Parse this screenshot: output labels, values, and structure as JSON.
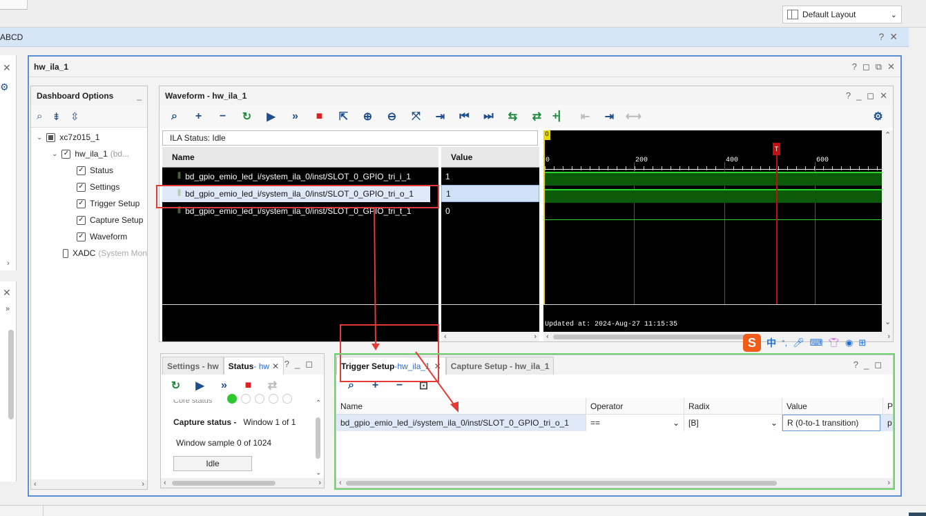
{
  "layout_selector": {
    "value": "Default Layout"
  },
  "project_bar": {
    "title": "ABCD"
  },
  "main_window": {
    "title": "hw_ila_1"
  },
  "dashboard": {
    "title": "Dashboard Options",
    "device": "xc7z015_1",
    "ila": "hw_ila_1",
    "ila_suffix": "(bd...",
    "items": [
      "Status",
      "Settings",
      "Trigger Setup",
      "Capture Setup",
      "Waveform"
    ],
    "xadc": "XADC",
    "xadc_suffix": "(System Mon"
  },
  "waveform": {
    "title": "Waveform - hw_ila_1",
    "ila_status": "ILA Status:  Idle",
    "name_header": "Name",
    "value_header": "Value",
    "signals": [
      {
        "name": "bd_gpio_emio_led_i/system_ila_0/inst/SLOT_0_GPIO_tri_i_1",
        "value": "1"
      },
      {
        "name": "bd_gpio_emio_led_i/system_ila_0/inst/SLOT_0_GPIO_tri_o_1",
        "value": "1"
      },
      {
        "name": "bd_gpio_emio_led_i/system_ila_0/inst/SLOT_0_GPIO_tri_t_1",
        "value": "0"
      }
    ],
    "ticks": [
      "0",
      "200",
      "400",
      "600"
    ],
    "zero_marker": "0",
    "trigger_marker": "T",
    "updated": "Updated at: 2024-Aug-27 11:15:35"
  },
  "status_panel": {
    "tab_settings": "Settings - hw",
    "tab_status": "Status",
    "tab_status_suffix": " - hw",
    "core_status_cut": "Core status",
    "capture_label": "Capture status -",
    "capture_window": "Window 1 of 1",
    "window_sample": "Window sample 0 of 1024",
    "state": "Idle"
  },
  "trigger_panel": {
    "tab_trigger": "Trigger Setup",
    "tab_trigger_suffix": "hw_ila_1",
    "tab_capture": "Capture Setup - hw_ila_1",
    "columns": [
      "Name",
      "Operator",
      "Radix",
      "Value",
      "P"
    ],
    "row": {
      "name": "bd_gpio_emio_led_i/system_ila_0/inst/SLOT_0_GPIO_tri_o_1",
      "operator": "==",
      "radix": "[B]",
      "value": "R (0-to-1 transition)",
      "port": "p"
    }
  },
  "ime_bar": {
    "brand": "S",
    "lang": "中"
  }
}
